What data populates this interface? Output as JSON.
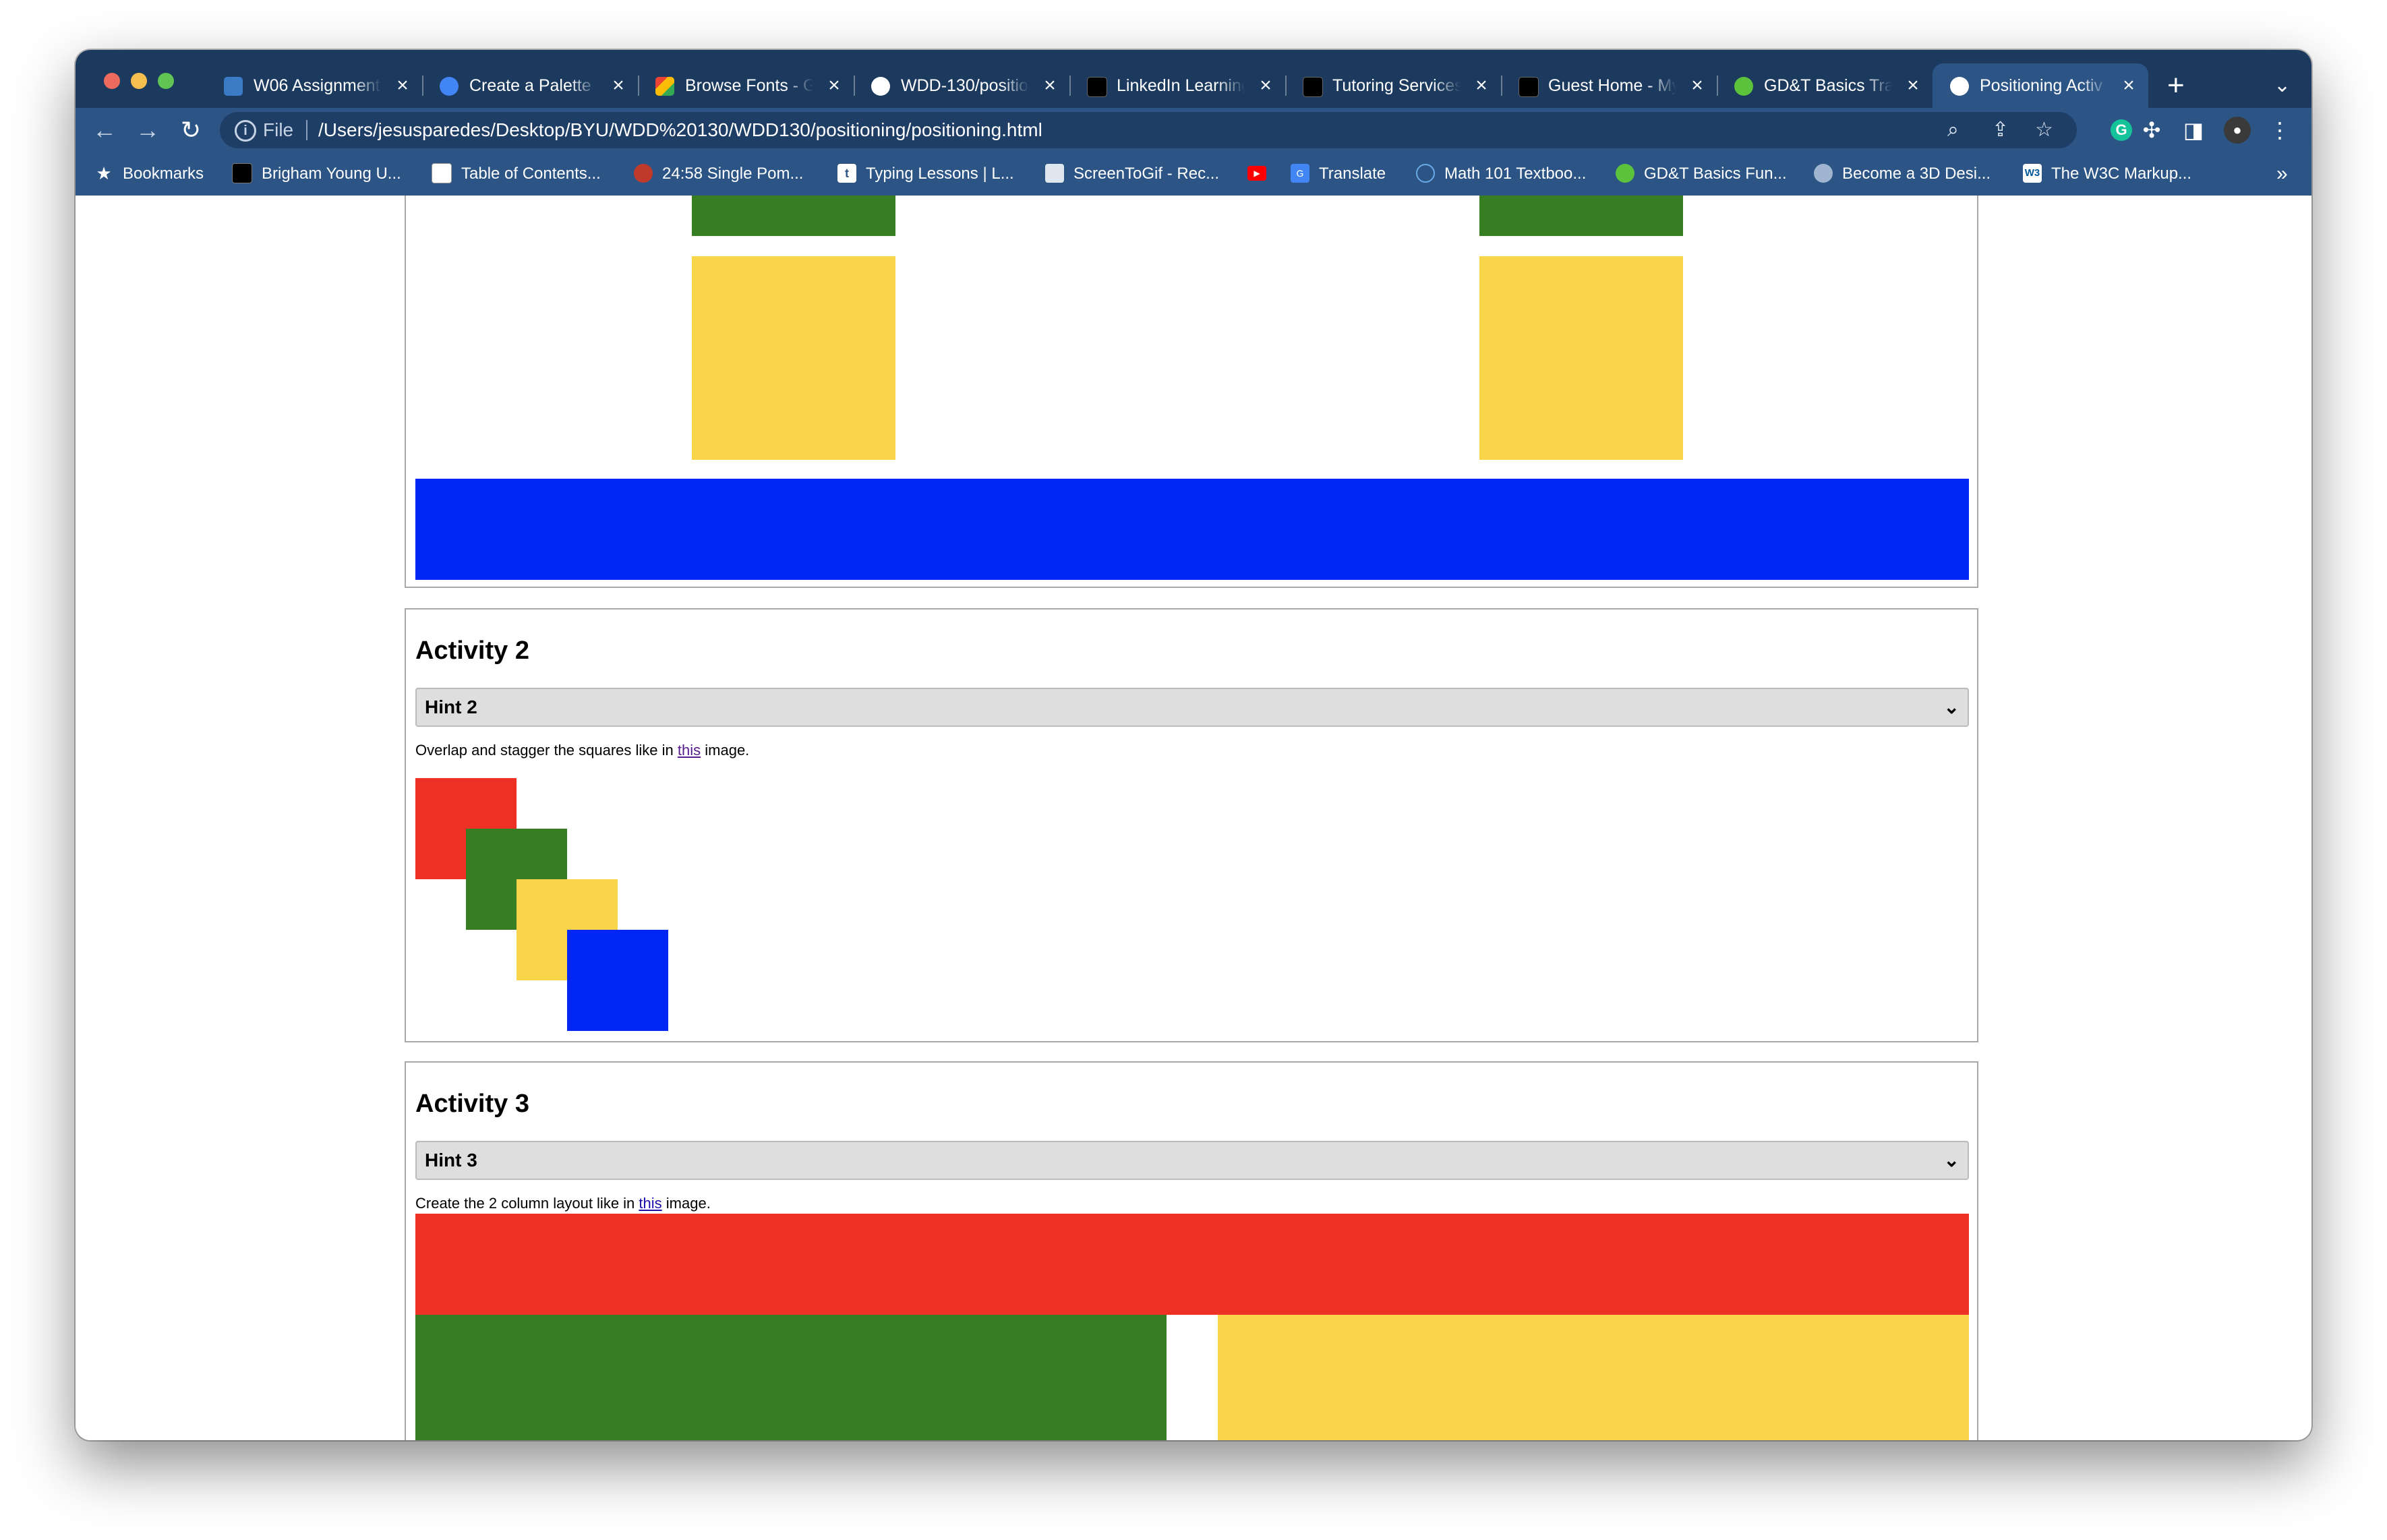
{
  "tabs": [
    {
      "title": "W06 Assignment",
      "favicon": "bar-chart-icon",
      "color": "#3c7bc6"
    },
    {
      "title": "Create a Palette",
      "favicon": "palette-icon",
      "color": "#4285f4"
    },
    {
      "title": "Browse Fonts - G",
      "favicon": "google-fonts-icon",
      "color": "#ea4335"
    },
    {
      "title": "WDD-130/positio",
      "favicon": "github-icon",
      "color": "#ffffff"
    },
    {
      "title": "LinkedIn Learning",
      "favicon": "byu-icon",
      "color": "#000000"
    },
    {
      "title": "Tutoring Services",
      "favicon": "byu-icon",
      "color": "#000000"
    },
    {
      "title": "Guest Home - My",
      "favicon": "byu-icon",
      "color": "#000000"
    },
    {
      "title": "GD&T Basics Tra",
      "favicon": "gear-icon",
      "color": "#5cc23c"
    },
    {
      "title": "Positioning Activ",
      "favicon": "globe-icon",
      "color": "#ffffff"
    }
  ],
  "new_tab": "+",
  "address": {
    "scheme": "File",
    "url": "/Users/jesusparedes/Desktop/BYU/WDD%20130/WDD130/positioning/positioning.html"
  },
  "bookmarks": [
    {
      "label": "Bookmarks",
      "icon": "star-icon"
    },
    {
      "label": "Brigham Young U...",
      "icon": "byu-icon"
    },
    {
      "label": "Table of Contents...",
      "icon": "book-icon"
    },
    {
      "label": "24:58 Single Pom...",
      "icon": "tomato-icon"
    },
    {
      "label": "Typing Lessons | L...",
      "icon": "typing-icon"
    },
    {
      "label": "ScreenToGif - Rec...",
      "icon": "screen-icon"
    },
    {
      "label": "",
      "icon": "youtube-icon"
    },
    {
      "label": "Translate",
      "icon": "translate-icon"
    },
    {
      "label": "Math 101 Textboo...",
      "icon": "math-icon"
    },
    {
      "label": "GD&T Basics Fun...",
      "icon": "gear-icon"
    },
    {
      "label": "Become a 3D Desi...",
      "icon": "globe-icon"
    },
    {
      "label": "The W3C Markup...",
      "icon": "w3c-icon"
    }
  ],
  "page": {
    "activity2": {
      "heading": "Activity 2",
      "hint": "Hint 2",
      "desc_before": "Overlap and stagger the squares like in ",
      "link": "this",
      "desc_after": " image."
    },
    "activity3": {
      "heading": "Activity 3",
      "hint": "Hint 3",
      "desc_before": "Create the 2 column layout like in ",
      "link": "this",
      "desc_after": " image."
    }
  },
  "colors": {
    "red": "#ee3124",
    "green": "#377d22",
    "yellow": "#f9d649",
    "blue": "#0026f5",
    "chrome": "#2c5586"
  }
}
